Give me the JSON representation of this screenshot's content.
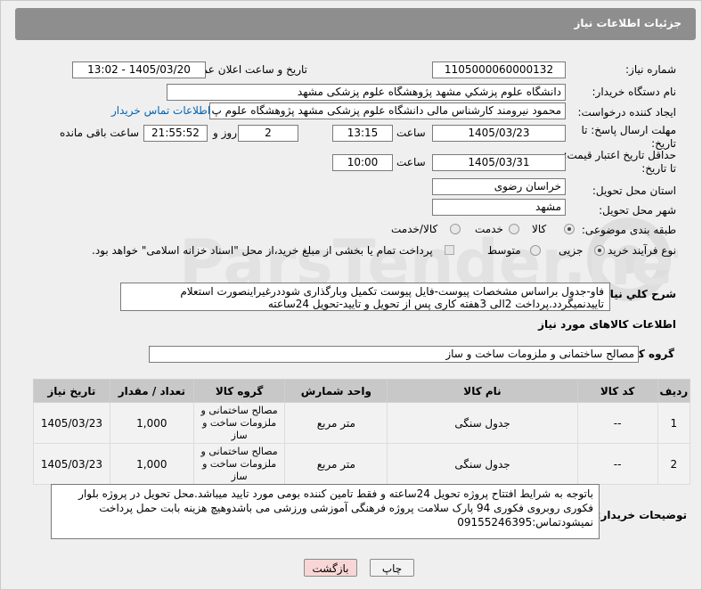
{
  "header": {
    "title": "جزئیات اطلاعات نیاز"
  },
  "form": {
    "need_number_label": "شماره نیاز:",
    "need_number": "1105000060000132",
    "announce_label": "تاریخ و ساعت اعلان عمومی:",
    "announce_value": "1405/03/20 - 13:02",
    "buyer_org_label": "نام دستگاه خریدار:",
    "buyer_org": "دانشگاه علوم پزشكي مشهد   پژوهشگاه علوم پزشکی مشهد",
    "requester_label": "ایجاد کننده درخواست:",
    "requester": "محمود نیرومند کارشناس مالی دانشگاه علوم پزشکی مشهد   پژوهشگاه علوم پ",
    "contact_link": "اطلاعات تماس خریدار",
    "deadline_label_1": "مهلت ارسال پاسخ: تا",
    "deadline_label_2": "تاریخ:",
    "deadline_date": "1405/03/23",
    "time_label": "ساعت",
    "deadline_time": "13:15",
    "days": "2",
    "days_label": "روز و",
    "remaining": "21:55:52",
    "remaining_label": "ساعت باقی مانده",
    "validity_label_1": "حداقل تاریخ اعتبار قیمت:",
    "validity_label_2": "تا تاریخ:",
    "validity_date": "1405/03/31",
    "validity_time_label": "ساعت",
    "validity_time": "10:00",
    "province_label": "استان محل تحویل:",
    "province": "خراسان رضوی",
    "city_label": "شهر محل تحویل:",
    "city": "مشهد",
    "category_label": "طبقه بندی موضوعی:",
    "category_options": [
      "کالا",
      "خدمت",
      "کالا/خدمت"
    ],
    "category_selected": "کالا",
    "process_label": "نوع فرآیند خرید :",
    "process_options": [
      "جزیی",
      "متوسط"
    ],
    "process_selected": "جزیی",
    "payment_note": "پرداخت تمام یا بخشی از مبلغ خرید،از محل \"اسناد خزانه اسلامی\" خواهد بود.",
    "description_label": "شرح کلي نیاز:",
    "description": "فاو-جدول براساس مشخصات پیوست-فایل پیوست تکمیل وبارگذاری شوددرغیراینصورت استعلام تاییدنمیگردد.پرداخت 2الی 3هفته کاری پس از تحویل و تایید-تحویل 24ساعته"
  },
  "goods": {
    "section_title": "اطلاعات کالاهای مورد نیاز",
    "group_label": "گروه کالا:",
    "group_value": "مصالح ساختمانی و ملزومات ساخت و ساز",
    "columns": [
      "ردیف",
      "کد کالا",
      "نام کالا",
      "واحد شمارش",
      "گروه کالا",
      "تعداد / مقدار",
      "تاریخ نیاز"
    ],
    "rows": [
      {
        "row": "1",
        "code": "--",
        "name": "جدول سنگی",
        "unit": "متر مربع",
        "group": "مصالح ساختمانی و ملزومات ساخت و ساز",
        "qty": "1,000",
        "date": "1405/03/23"
      },
      {
        "row": "2",
        "code": "--",
        "name": "جدول سنگی",
        "unit": "متر مربع",
        "group": "مصالح ساختمانی و ملزومات ساخت و ساز",
        "qty": "1,000",
        "date": "1405/03/23"
      }
    ]
  },
  "buyer_notes": {
    "label": "توضیحات خریدار:",
    "text": "باتوجه به شرایط افتتاح پروژه تحویل 24ساعته و فقط تامین کننده بومی مورد تایید میباشد.محل تحویل در پروژه بلوار فکوری روبروی فکوری 94 پارک سلامت پروژه فرهنگی آموزشی ورزشی می باشدوهیچ هزینه بابت حمل  پرداخت نمیشودتماس:09155246395"
  },
  "buttons": {
    "print": "چاپ",
    "back": "بازگشت"
  },
  "colors": {
    "header": "#8e8e8e",
    "link": "#0066b3",
    "back_button": "#f9d6d6",
    "watermark": "#d9d9d9"
  },
  "watermark": {
    "icon": "tender-logo-icon",
    "text": "ParsTender.net"
  }
}
